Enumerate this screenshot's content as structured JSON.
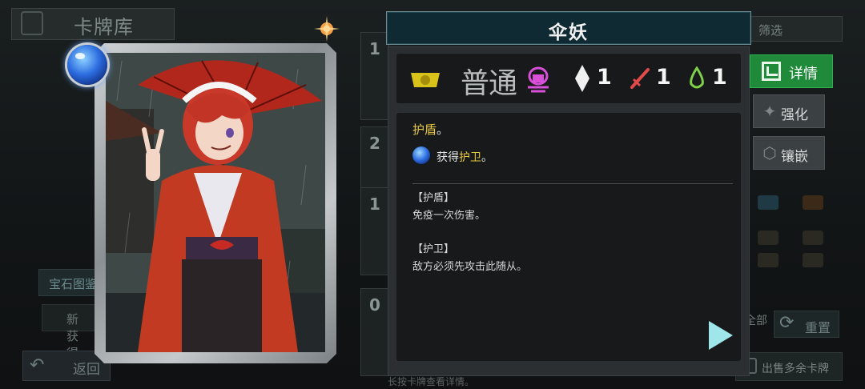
{
  "background": {
    "library_title": "卡牌库",
    "filter_label": "筛选",
    "gem_guide_label": "宝石图鉴",
    "new_label": "新获得",
    "back_label": "返回",
    "hint_text": "长按卡牌查看详情。",
    "all_label": "全部",
    "reset_label": "重置",
    "sell_label": "出售多余卡牌",
    "card_counts": [
      "1",
      "2",
      "1",
      "0"
    ]
  },
  "card": {
    "name": "伞妖",
    "rarity": "普通",
    "stats": {
      "crystal": "1",
      "attack": "1",
      "health": "1"
    },
    "effect": {
      "keyword": "护盾",
      "suffix": "。",
      "gain_prefix": "获得",
      "gain_keyword": "护卫",
      "gain_suffix": "。"
    },
    "keywords": [
      {
        "title": "【护盾】",
        "text": "免疫一次伤害。"
      },
      {
        "title": "【护卫】",
        "text": "敌方必须先攻击此随从。"
      }
    ]
  },
  "actions": {
    "detail_label": "详情",
    "upgrade_label": "强化",
    "inlay_label": "镶嵌"
  },
  "colors": {
    "accent_green": "#1f8a3a",
    "keyword_yellow": "#e8c843",
    "title_bg": "#0f2a33"
  }
}
